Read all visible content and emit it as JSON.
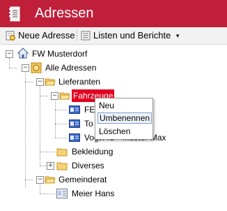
{
  "app": {
    "title": "Adressen",
    "accent": "#c01f3a"
  },
  "toolbar": {
    "new_label": "Neue Adresse",
    "lists_label": "Listen und Berichte",
    "lists_caret": "▾"
  },
  "tree": {
    "root": "FW Musterdorf",
    "all": "Alle Adressen",
    "suppliers": "Lieferanten",
    "vehicles": "Fahrzeuge",
    "vehicle_items": [
      "FE",
      "To",
      "Vogt AG - Muster Max"
    ],
    "clothing": "Bekleidung",
    "misc": "Diverses",
    "council": "Gemeinderat",
    "council_person": "Meier Hans",
    "expander_minus": "−",
    "expander_plus": "+"
  },
  "context_menu": {
    "items": [
      "Neu",
      "Umbenennen",
      "Löschen"
    ],
    "hovered_index": 1
  }
}
